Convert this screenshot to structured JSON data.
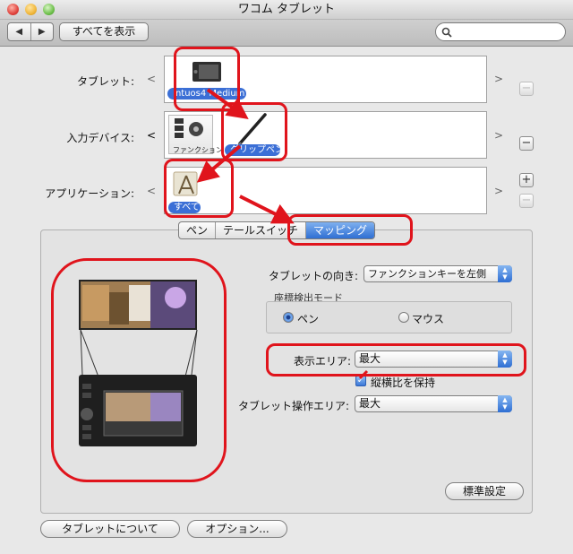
{
  "window": {
    "title": "ワコム タブレット"
  },
  "toolbar": {
    "back": "◀",
    "forward": "▶",
    "show_all": "すべてを表示",
    "search_placeholder": ""
  },
  "rows": {
    "tablet": {
      "label": "タブレット:",
      "item": "Intuos4 Medium"
    },
    "input_device": {
      "label": "入力デバイス:",
      "items": [
        "ファンクション",
        "グリップペン"
      ]
    },
    "application": {
      "label": "アプリケーション:",
      "item": "すべて"
    }
  },
  "scroll": {
    "left": "<",
    "right": ">"
  },
  "buttons": {
    "plus": "+",
    "minus": "−"
  },
  "tabs": [
    "ペン",
    "テールスイッチ",
    "マッピング"
  ],
  "selected_tab": "マッピング",
  "mapping": {
    "orientation_label": "タブレットの向き:",
    "orientation_value": "ファンクションキーを左側",
    "mode_label": "座標検出モード",
    "mode_pen": "ペン",
    "mode_mouse": "マウス",
    "mode_selected": "ペン",
    "display_area_label": "表示エリア:",
    "display_area_value": "最大",
    "keep_ratio_label": "縦横比を保持",
    "keep_ratio_checked": true,
    "tablet_area_label": "タブレット操作エリア:",
    "tablet_area_value": "最大",
    "default_button": "標準設定"
  },
  "footer": {
    "about": "タブレットについて",
    "options": "オプション..."
  },
  "colors": {
    "accent": "#3b6fd6",
    "highlight": "#e0141c"
  }
}
